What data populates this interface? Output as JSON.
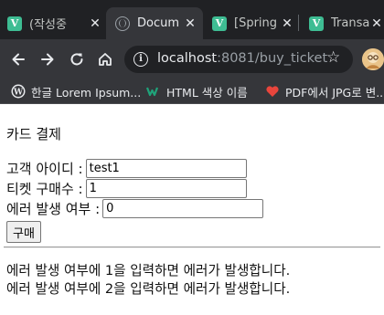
{
  "browser": {
    "tabs": [
      {
        "title": "(작성중",
        "favicon": "vuepress-v-icon",
        "active": false
      },
      {
        "title": "Docum",
        "favicon": "globe-icon",
        "active": true
      },
      {
        "title": "[Spring",
        "favicon": "vuepress-v-icon",
        "active": false
      },
      {
        "title": "Transac",
        "favicon": "vuepress-v-icon",
        "active": false
      }
    ],
    "favicon_letter": "V",
    "close_glyph": "✕",
    "url_host": "localhost",
    "url_rest": ":8081/buy_ticket",
    "bookmarks": [
      {
        "label": "한글 Lorem Ipsum...",
        "icon": "wordpress-icon"
      },
      {
        "label": "HTML 색상 이름",
        "icon": "w-logo-icon"
      },
      {
        "label": "PDF에서 JPG로 변...",
        "icon": "heart-icon"
      }
    ],
    "colors": {
      "tab_bg": "#202124",
      "toolbar_bg": "#35363a",
      "favicon_green": "#3ebd93"
    }
  },
  "page": {
    "title": "카드 결제",
    "fields": {
      "customer_id": {
        "label": "고객 아이디 :",
        "value": "test1"
      },
      "ticket_count": {
        "label": "티켓 구매수 :",
        "value": "1"
      },
      "error_flag": {
        "label": "에러 발생 여부 :",
        "value": "0"
      }
    },
    "buy_button": "구매",
    "notes": [
      "에러 발생 여부에 1을 입력하면 에러가 발생합니다.",
      "에러 발생 여부에 2을 입력하면 에러가 발생합니다."
    ]
  }
}
